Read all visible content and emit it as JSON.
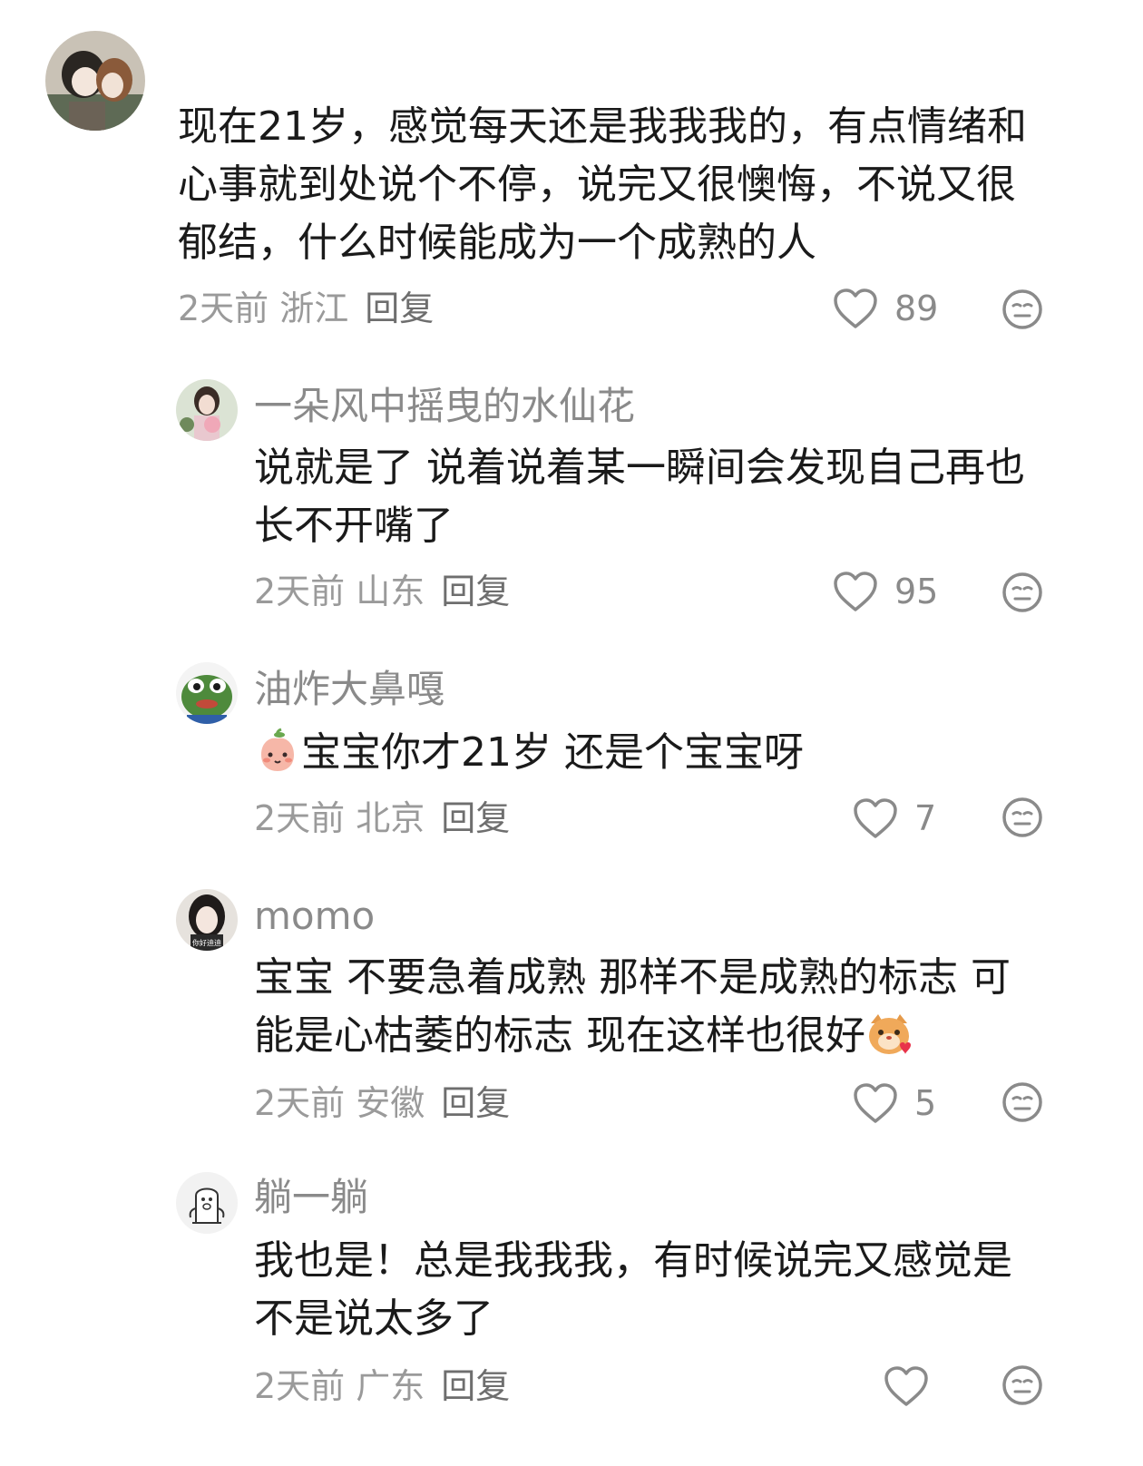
{
  "comments": [
    {
      "username": "",
      "text": "现在21岁，感觉每天还是我我我的，有点情绪和心事就到处说个不停，说完又很懊悔，不说又很郁结，什么时候能成为一个成熟的人",
      "time": "2天前",
      "location": "浙江",
      "reply_label": "回复",
      "likes": "89",
      "avatar_icon": "anime-girls-avatar"
    },
    {
      "username": "一朵风中摇曳的水仙花",
      "text": "说就是了 说着说着某一瞬间会发现自己再也长不开嘴了",
      "time": "2天前",
      "location": "山东",
      "reply_label": "回复",
      "likes": "95",
      "avatar_icon": "woman-with-flowers-avatar"
    },
    {
      "username": "油炸大鼻嘎",
      "text": "宝宝你才21岁 还是个宝宝呀",
      "time": "2天前",
      "location": "北京",
      "reply_label": "回复",
      "likes": "7",
      "avatar_icon": "green-frog-avatar",
      "inline_emoji": "peach-face-emoji"
    },
    {
      "username": "momo",
      "text_line1": "宝宝 不要急着成熟 那样不是成熟的标志 可",
      "text_line2": "能是心枯萎的标志 现在这样也很好",
      "time": "2天前",
      "location": "安徽",
      "reply_label": "回复",
      "likes": "5",
      "avatar_icon": "girl-portrait-avatar",
      "avatar_caption": "你好迪迪",
      "trailing_emoji": "cat-heart-emoji"
    },
    {
      "username": "躺一躺",
      "text": "我也是！总是我我我，有时候说完又感觉是不是说太多了",
      "time": "2天前",
      "location": "广东",
      "reply_label": "回复",
      "likes": "",
      "avatar_icon": "cartoon-doodle-avatar"
    }
  ],
  "icons": {
    "like": "heart-outline-icon",
    "dislike": "neutral-face-icon"
  },
  "colors": {
    "meta_gray": "#9a9a9a",
    "username_gray": "#8a8a8a",
    "text": "#1a1a1a"
  }
}
